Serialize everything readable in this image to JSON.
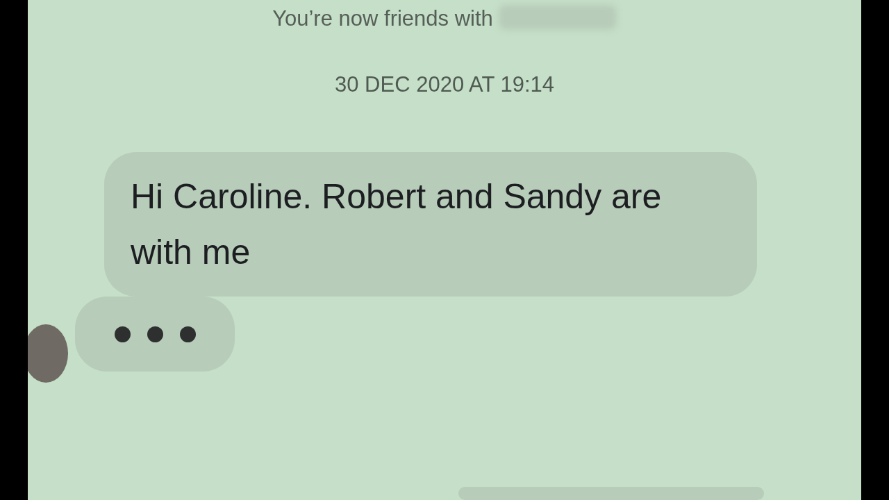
{
  "notice": {
    "text": "You’re now friends with"
  },
  "timestamp": "30 DEC 2020 AT 19:14",
  "messages": [
    {
      "kind": "text",
      "text": "Hi Caroline. Robert and Sandy are with me"
    },
    {
      "kind": "typing"
    },
    {
      "kind": "cropped"
    }
  ]
}
